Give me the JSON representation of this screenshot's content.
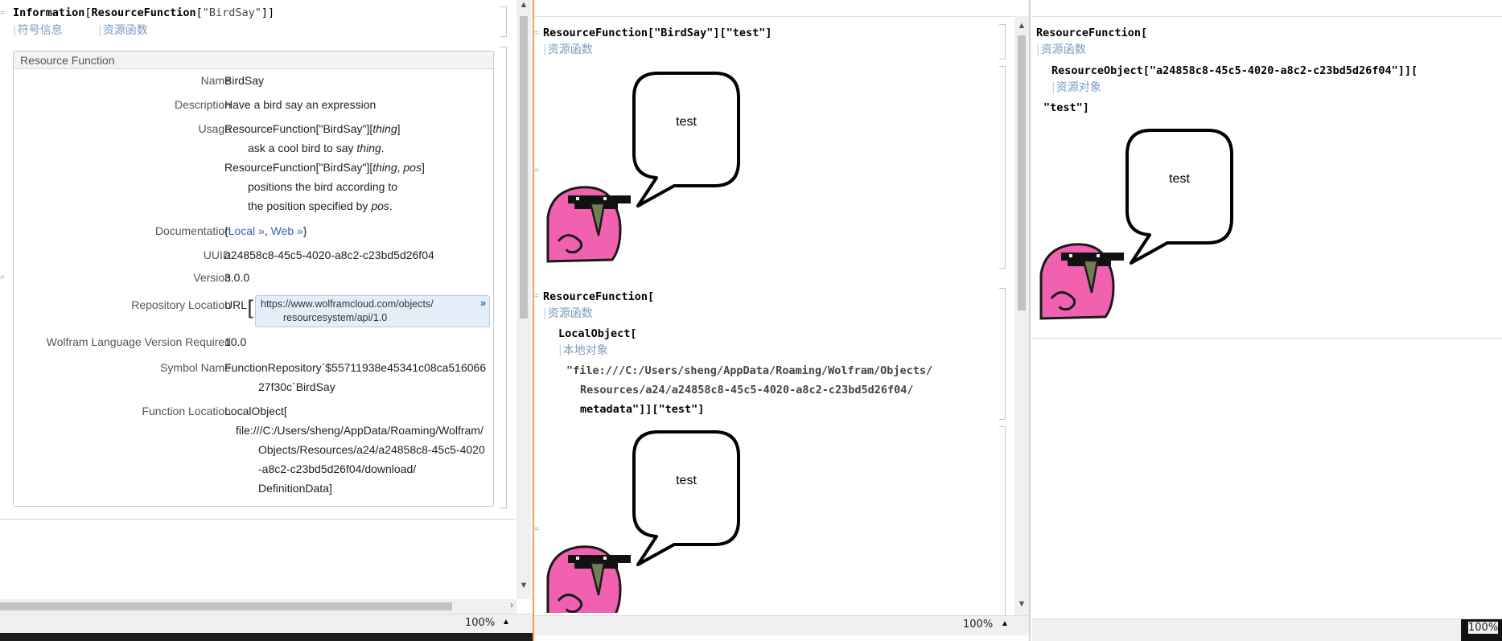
{
  "left": {
    "input": {
      "head": "Information",
      "bracket_open": "[",
      "mid": "ResourceFunction",
      "bracket_open2": "[",
      "arg": "\"BirdSay\"",
      "close": "]]"
    },
    "input_tags": [
      "符号信息",
      "资源函数"
    ],
    "panel_title": "Resource Function",
    "name_key": "Name",
    "name_val": "BirdSay",
    "desc_key": "Description",
    "desc_val": "Have a bird say an expression",
    "usage_key": "Usage",
    "usage1_a": "ResourceFunction[\"BirdSay\"][",
    "usage1_b": "thing",
    "usage1_c": "]",
    "usage1_desc_a": "ask a cool bird to say ",
    "usage1_desc_b": "thing",
    "usage1_desc_c": ".",
    "usage2_a": "ResourceFunction[\"BirdSay\"][",
    "usage2_b": "thing",
    "usage2_c": ", ",
    "usage2_d": "pos",
    "usage2_e": "]",
    "usage2_desc1": "positions the bird according to",
    "usage2_desc2_a": "the position specified by ",
    "usage2_desc2_b": "pos",
    "usage2_desc2_c": ".",
    "doc_key": "Documentation",
    "doc_open": "{",
    "doc_local": "Local »",
    "doc_sep": ", ",
    "doc_web": "Web »",
    "doc_close": "}",
    "uuid_key": "UUID",
    "uuid_val": "a24858c8-45c5-4020-a8c2-c23bd5d26f04",
    "version_key": "Version",
    "version_val": "3.0.0",
    "repo_key": "Repository Location",
    "repo_prefix": "URL",
    "repo_url1": "https://www.wolframcloud.com/objects/",
    "repo_url2": "resourcesystem/api/1.0",
    "repo_more": "»",
    "wl_key": "Wolfram Language Version Required",
    "wl_val": "10.0",
    "sym_key": "Symbol Name",
    "sym_val1": "FunctionRepository`$55711938e45341c08ca516066",
    "sym_val2": "27f30c`BirdSay",
    "loc_key": "Function Location",
    "loc_val1": "LocalObject[",
    "loc_val2": "file:///C:/Users/sheng/AppData/Roaming/Wolfram/",
    "loc_val3": "Objects/Resources/a24/a24858c8-45c5-4020",
    "loc_val4": "-a8c2-c23bd5d26f04/download/",
    "loc_val5": "DefinitionData]",
    "zoom": "100%"
  },
  "middle": {
    "in1": "ResourceFunction[\"BirdSay\"][\"test\"]",
    "in1_tag": "资源函数",
    "bubble1": "test",
    "in2_line1": "ResourceFunction[",
    "in2_tag": "资源函数",
    "in2_line2": "LocalObject[",
    "in2_tag2": "本地对象",
    "in2_line3": "\"file:///C:/Users/sheng/AppData/Roaming/Wolfram/Objects/",
    "in2_line4": "Resources/a24/a24858c8-45c5-4020-a8c2-c23bd5d26f04/",
    "in2_line5": "metadata\"]][\"test\"]",
    "bubble2": "test",
    "zoom": "100%"
  },
  "right": {
    "line1": "ResourceFunction[",
    "tag1": "资源函数",
    "line2": "ResourceObject[\"a24858c8-45c5-4020-a8c2-c23bd5d26f04\"]][",
    "tag2": "资源对象",
    "line3": "\"test\"]",
    "bubble": "test",
    "zoom": "100%"
  },
  "colors": {
    "bird_body": "#f062b0",
    "bird_outline": "#1a1a1a",
    "beak": "#6f7f4f",
    "tag_text": "#7a9ac0",
    "link": "#3b5fb8",
    "window_chrome": "#f0f0f0",
    "active_border": "#e8a060"
  }
}
